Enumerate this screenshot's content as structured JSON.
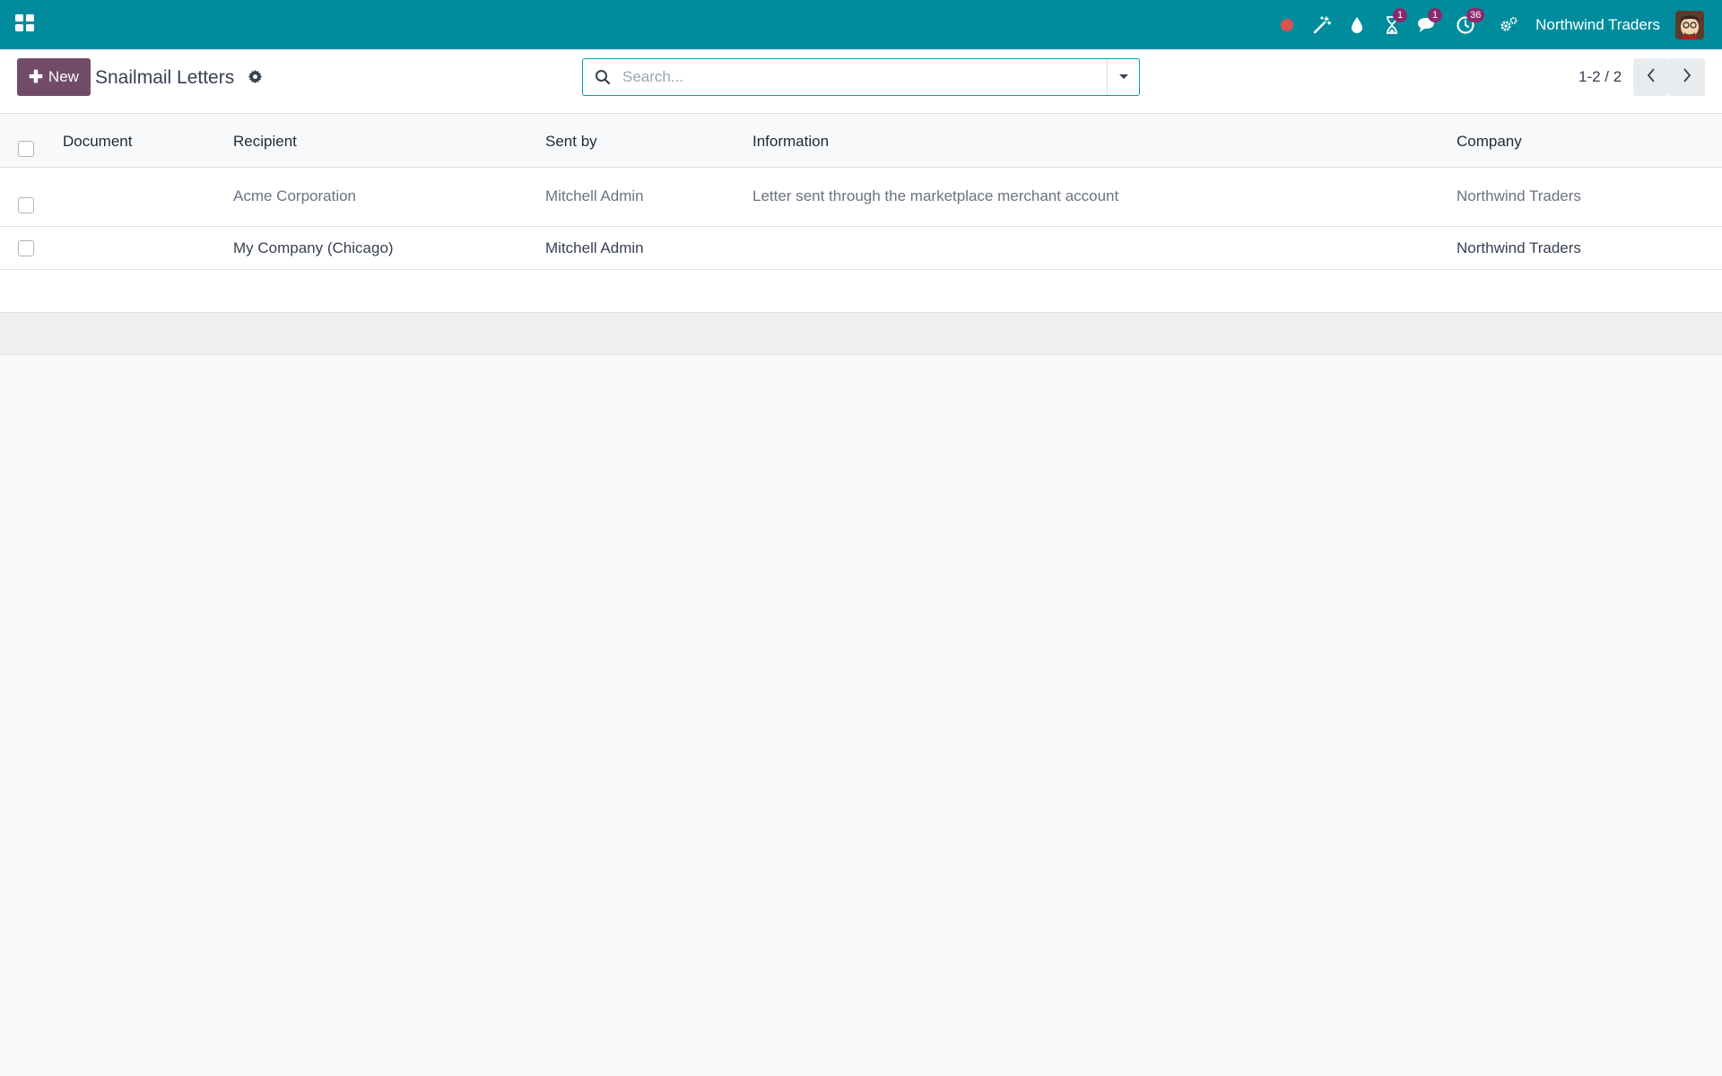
{
  "navbar": {
    "company": "Northwind Traders",
    "activities_badge": "1",
    "messages_badge": "1",
    "timer_badge": "36",
    "brand_color": "#008c9c",
    "badge_color": "#8a2a6d"
  },
  "control_panel": {
    "new_label": "New",
    "title": "Snailmail Letters",
    "search_placeholder": "Search...",
    "pager": "1-2 / 2",
    "accent": "#714b67"
  },
  "list": {
    "columns": [
      "Document",
      "Recipient",
      "Sent by",
      "Information",
      "Company"
    ],
    "rows": [
      {
        "document": "",
        "recipient": "Acme Corporation",
        "sent_by": "Mitchell Admin",
        "information": "Letter sent through the marketplace merchant account",
        "company": "Northwind Traders",
        "muted": true
      },
      {
        "document": "",
        "recipient": "My Company (Chicago)",
        "sent_by": "Mitchell Admin",
        "information": "",
        "company": "Northwind Traders",
        "muted": false
      }
    ]
  },
  "icons": [
    "apps-icon",
    "record-dot-icon",
    "magic-wand-icon",
    "drop-icon",
    "hourglass-icon",
    "chat-icon",
    "clock-icon",
    "settings-icon",
    "search-icon",
    "caret-down-icon",
    "gear-icon",
    "chevron-left-icon",
    "chevron-right-icon"
  ]
}
